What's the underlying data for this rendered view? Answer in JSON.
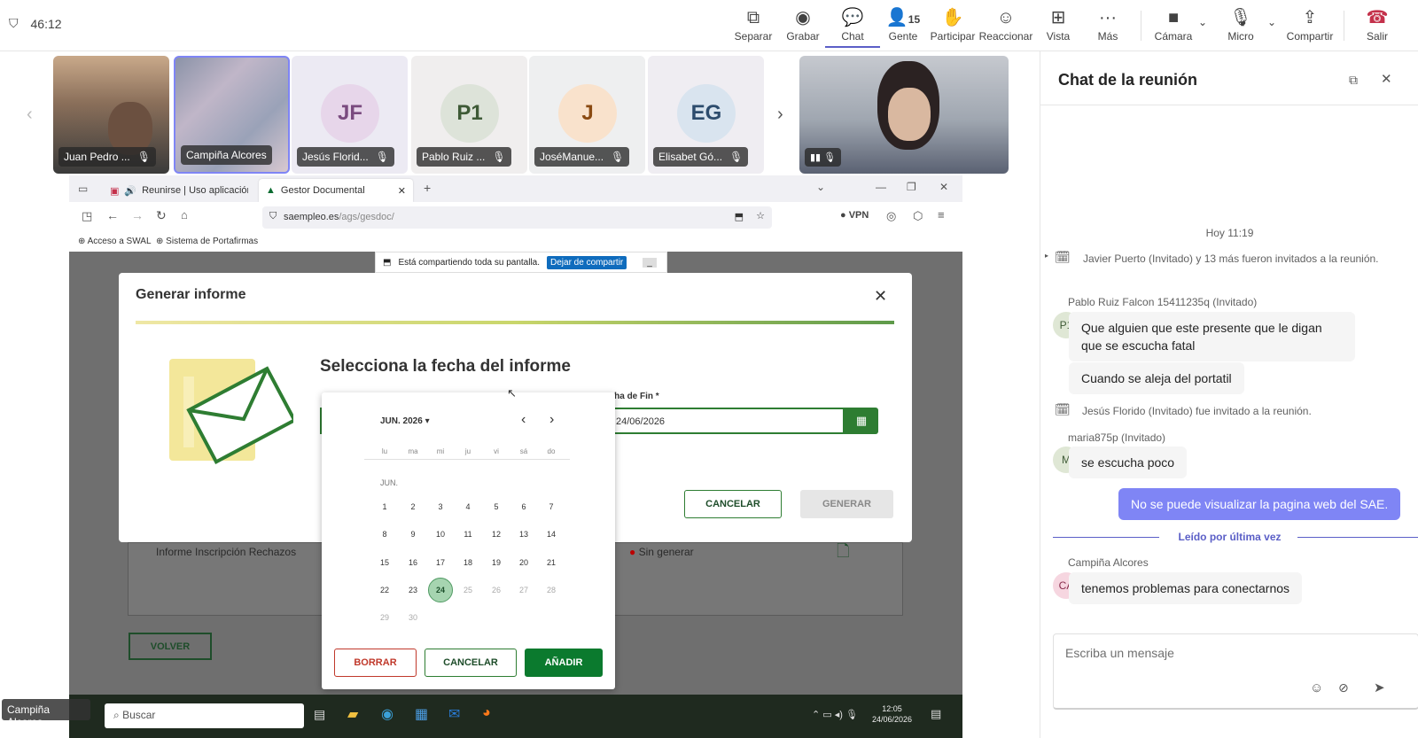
{
  "teams": {
    "timer": "46:12",
    "toolbar": [
      {
        "label": "Separar",
        "icon": "pop-out-icon"
      },
      {
        "label": "Grabar",
        "icon": "record-icon"
      },
      {
        "label": "Chat",
        "icon": "chat-icon"
      },
      {
        "label": "Gente",
        "icon": "people-icon",
        "count": "15"
      },
      {
        "label": "Participar",
        "icon": "raise-hand-icon"
      },
      {
        "label": "Reaccionar",
        "icon": "react-icon"
      },
      {
        "label": "Vista",
        "icon": "view-icon"
      },
      {
        "label": "Más",
        "icon": "more-icon"
      },
      {
        "label": "Cámara",
        "icon": "camera-icon"
      },
      {
        "label": "Micro",
        "icon": "mic-off-icon"
      },
      {
        "label": "Compartir",
        "icon": "share-icon"
      },
      {
        "label": "Salir",
        "icon": "leave-icon"
      }
    ],
    "participants": [
      {
        "name": "Juan Pedro ...",
        "initials": "",
        "video": true
      },
      {
        "name": "Campiña Alcores",
        "initials": "",
        "video": true
      },
      {
        "name": "Jesús Florid...",
        "initials": "JF"
      },
      {
        "name": "Pablo Ruiz ...",
        "initials": "P1"
      },
      {
        "name": "JoséManue...",
        "initials": "J"
      },
      {
        "name": "Elisabet Gó...",
        "initials": "EG"
      }
    ],
    "presenter_label": "Campiña Alcores"
  },
  "browser": {
    "tabs": [
      {
        "label": "Reunirse | Uso aplicación S/"
      },
      {
        "label": "Gestor Documental"
      }
    ],
    "url_domain": "saempleo.es",
    "url_path": "/ags/gesdoc/",
    "vpn_label": "VPN",
    "bookmarks": [
      "Acceso a SWAL",
      "Sistema de Portafirmas"
    ],
    "share_notice": "Está compartiendo toda su pantalla.",
    "share_stop": "Dejar de compartir"
  },
  "modal": {
    "title": "Generar informe",
    "heading": "Selecciona la fecha del informe",
    "end_label": "echa de Fin *",
    "end_value": "24/06/2026",
    "cancel": "CANCELAR",
    "generate": "GENERAR"
  },
  "background_page": {
    "row_label": "Informe Inscripción Rechazos",
    "row_status": "Sin generar",
    "back_button": "VOLVER"
  },
  "calendar": {
    "month_label": "JUN. 2026",
    "month_short": "JUN.",
    "weekdays": [
      "lu",
      "ma",
      "mi",
      "ju",
      "vi",
      "sá",
      "do"
    ],
    "selected_day": 24,
    "days_in_month": 30,
    "first_weekday_index": 0,
    "clear": "BORRAR",
    "cancel": "CANCELAR",
    "add": "AÑADIR"
  },
  "taskbar": {
    "search": "Buscar",
    "time": "12:05",
    "date": "24/06/2026"
  },
  "chat": {
    "title": "Chat de la reunión",
    "date_divider": "Hoy 11:19",
    "sys1": "Javier Puerto (Invitado) y 13 más fueron invitados a la reunión.",
    "sender1": "Pablo Ruiz Falcon 15411235q (Invitado)",
    "avatar1": "P1",
    "msg1a": "Que alguien que este presente que le digan que se escucha fatal",
    "msg1b": "Cuando se aleja del portatil",
    "sys2": "Jesús Florido (Invitado) fue invitado a la reunión.",
    "sender2": "maria875p (Invitado)",
    "avatar2": "M",
    "msg2": "se escucha poco",
    "own_msg": "No se puede visualizar la pagina web del SAE.",
    "last_read": "Leído por última vez",
    "sender3": "Campiña Alcores",
    "avatar3": "CA",
    "msg3": "tenemos problemas para conectarnos",
    "input_placeholder": "Escriba un mensaje"
  }
}
